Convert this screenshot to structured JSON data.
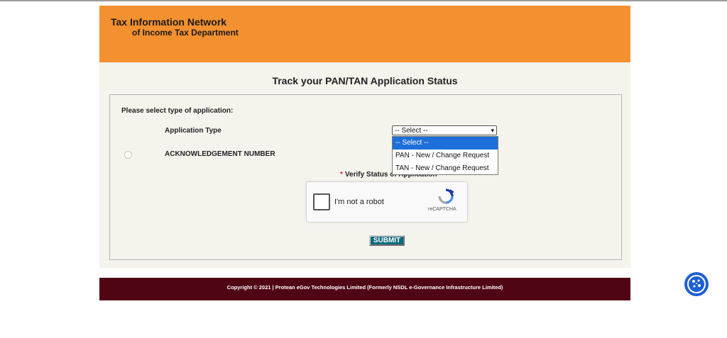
{
  "header": {
    "line1": "Tax Information Network",
    "line2": "of Income Tax Department",
    "bg_color": "#f39030"
  },
  "main": {
    "title": "Track your PAN/TAN Application Status",
    "select_prompt": "Please select type of application:",
    "application_type_label": "Application Type",
    "application_type_value": "-- Select --",
    "application_type_options": [
      "-- Select --",
      "PAN - New / Change Request",
      "TAN - New / Change Request"
    ],
    "acknowledgement_label": "ACKNOWLEDGEMENT NUMBER",
    "verify_label": "Verify Status of Application",
    "captcha_text": "I'm not a robot",
    "captcha_brand": "reCAPTCHA",
    "submit_label": "SUBMIT"
  },
  "footer": {
    "text": "Copyright © 2021 | Protean eGov Technologies Limited (Formerly NSDL e-Governance Infrastructure Limited)",
    "bg_color": "#500514"
  },
  "icons": {
    "cookie": "cookie-icon",
    "captcha": "recaptcha-logo-icon"
  }
}
